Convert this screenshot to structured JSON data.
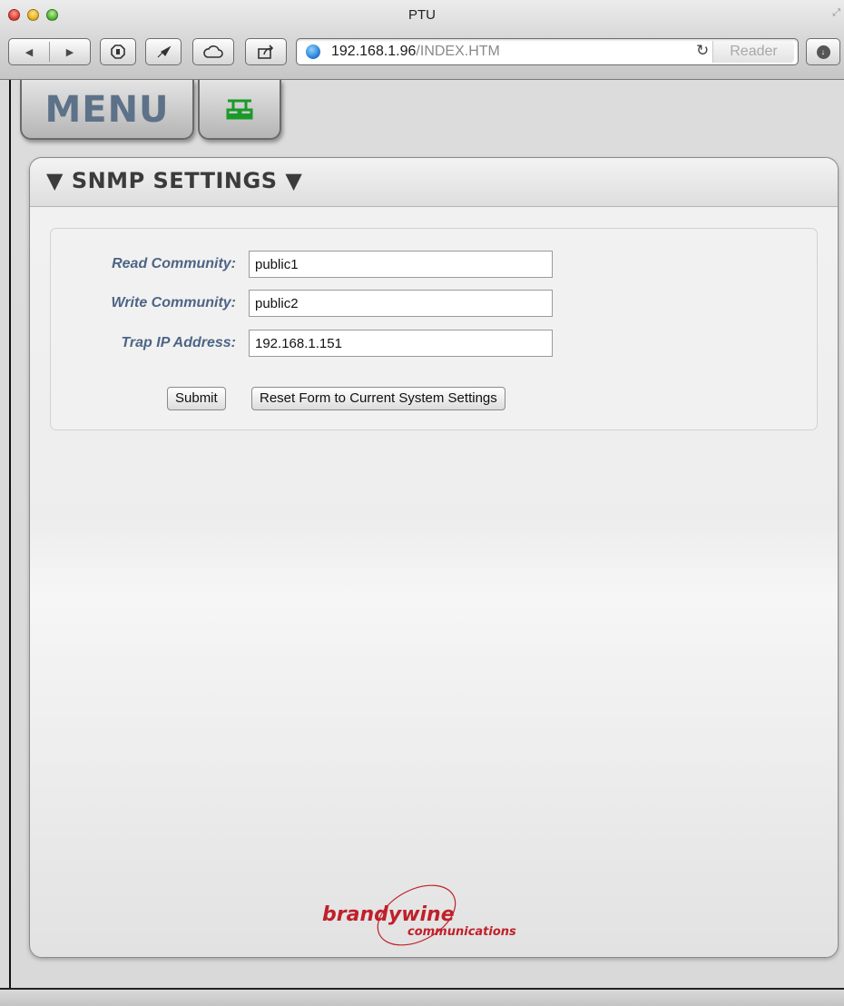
{
  "window": {
    "title": "PTU",
    "url_host": "192.168.1.96",
    "url_path": "/INDEX.HTM",
    "reader_label": "Reader",
    "reload_icon": "reload-icon",
    "nav_icons": [
      "back-icon",
      "forward-icon"
    ],
    "toolbar_icons": [
      "stop-icon",
      "bookmark-icon",
      "cloud-icon",
      "share-icon"
    ],
    "download_icon": "download-icon"
  },
  "nav": {
    "menu_label": "MENU",
    "network_icon": "network-icon"
  },
  "panel": {
    "title": "▼ SNMP SETTINGS ▼"
  },
  "form": {
    "read_community_label": "Read Community:",
    "read_community_value": "public1",
    "write_community_label": "Write Community:",
    "write_community_value": "public2",
    "trap_ip_label": "Trap IP Address:",
    "trap_ip_value": "192.168.1.151",
    "submit_label": "Submit",
    "reset_label": "Reset Form to Current System Settings"
  },
  "logo": {
    "text_main": "brandywine",
    "text_sub": "communications"
  },
  "colors": {
    "label_blue": "#4d6585",
    "menu_text": "#5d7288",
    "network_icon": "#1a9a2a",
    "logo_red": "#c0202a"
  }
}
